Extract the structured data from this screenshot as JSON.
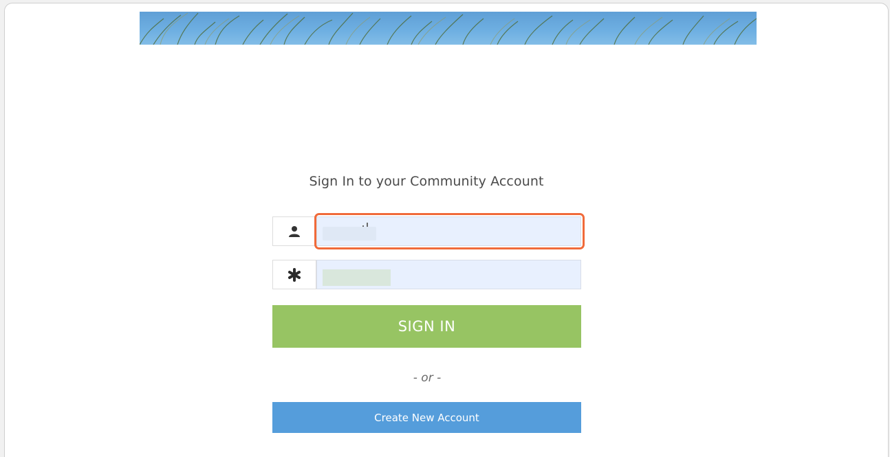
{
  "page": {
    "title": "Sign In to your Community Account"
  },
  "form": {
    "username_value": "",
    "password_value": "",
    "signin_label": "SIGN IN",
    "or_text": "- or -",
    "create_label": "Create New Account"
  },
  "icons": {
    "user": "user-icon",
    "password": "asterisk-icon"
  },
  "colors": {
    "signin_bg": "#97c463",
    "create_bg": "#559ddb",
    "focus_outline": "#f06a3a",
    "field_bg": "#e8f0fe"
  }
}
